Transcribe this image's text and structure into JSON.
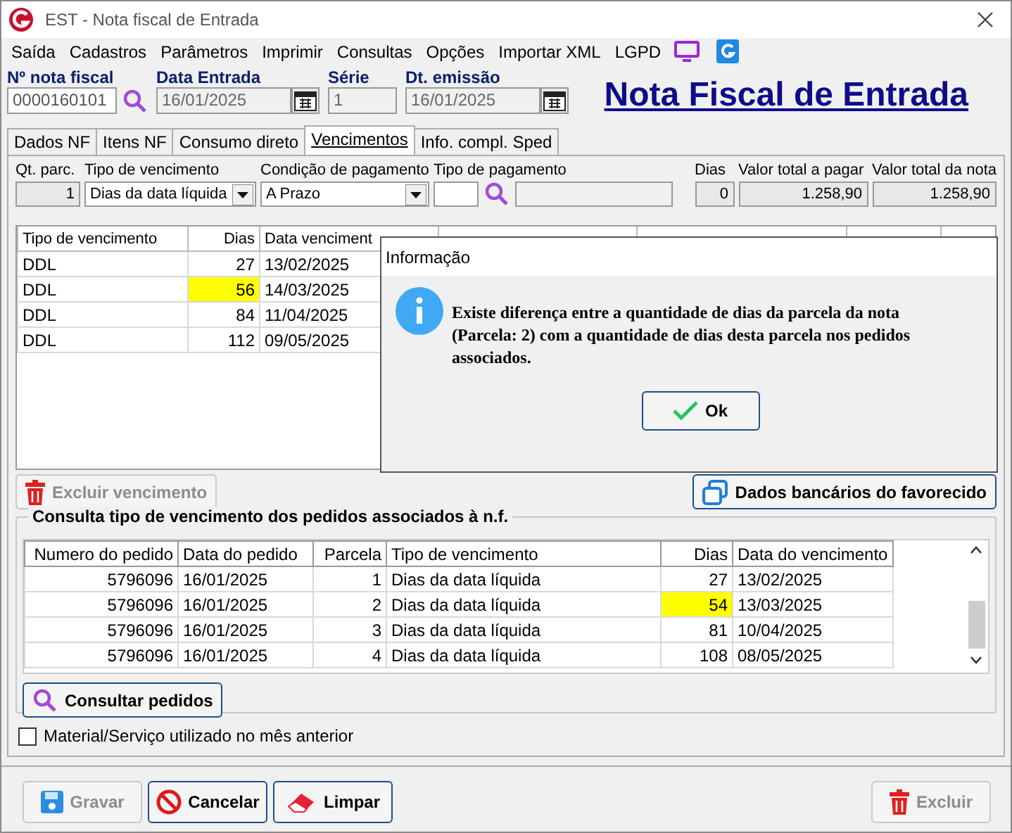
{
  "window": {
    "title": "EST - Nota fiscal de Entrada"
  },
  "menu": [
    {
      "label": "Saída"
    },
    {
      "label": "Cadastros"
    },
    {
      "label": "Parâmetros"
    },
    {
      "label": "Imprimir"
    },
    {
      "label": "Consultas"
    },
    {
      "label": "Opções"
    },
    {
      "label": "Importar XML"
    },
    {
      "label": "LGPD"
    }
  ],
  "header_fields": [
    {
      "label": "Nº nota fiscal",
      "value": "0000160101",
      "kind": "search"
    },
    {
      "label": "Data Entrada",
      "value": "16/01/2025",
      "kind": "date"
    },
    {
      "label": "Série",
      "value": "1",
      "kind": "text"
    },
    {
      "label": "Dt. emissão",
      "value": "16/01/2025",
      "kind": "date"
    }
  ],
  "page_title": "Nota Fiscal de Entrada",
  "tabs": [
    {
      "label": "Dados NF",
      "selected": false
    },
    {
      "label": "Itens NF",
      "selected": false
    },
    {
      "label": "Consumo direto",
      "selected": false
    },
    {
      "label": "Vencimentos",
      "selected": true
    },
    {
      "label": "Info. compl. Sped",
      "selected": false
    }
  ],
  "parcel_fields": [
    {
      "label": "Qt. parc.",
      "value": "1",
      "kind": "number"
    },
    {
      "label": "Tipo de vencimento",
      "value": "Dias da data líquida",
      "kind": "dropdown"
    },
    {
      "label": "Condição de pagamento",
      "value": "A Prazo",
      "kind": "dropdown"
    },
    {
      "label": "Tipo de pagamento",
      "kind": "lookup"
    },
    {
      "label": "Dias",
      "value": "0",
      "kind": "number"
    },
    {
      "label": "Valor total a pagar",
      "value": "1.258,90",
      "kind": "number"
    },
    {
      "label": "Valor total da nota",
      "value": "1.258,90",
      "kind": "number"
    }
  ],
  "vencimentos": {
    "columns": [
      "Tipo de vencimento",
      "Dias",
      "Data venciment"
    ],
    "rows": [
      {
        "cells": [
          "DDL",
          "27",
          "13/02/2025"
        ],
        "highlighted": false
      },
      {
        "cells": [
          "DDL",
          "56",
          "14/03/2025"
        ],
        "highlighted": true
      },
      {
        "cells": [
          "DDL",
          "84",
          "11/04/2025"
        ],
        "highlighted": false
      },
      {
        "cells": [
          "DDL",
          "112",
          "09/05/2025"
        ],
        "highlighted": false
      }
    ]
  },
  "excluir_vencimento": {
    "label": "Excluir vencimento",
    "disabled": true
  },
  "dados_bancarios": {
    "label": "Dados bancários do favorecido"
  },
  "pedidos": {
    "title": "Consulta tipo de vencimento dos pedidos associados à n.f.",
    "columns": [
      "Numero do pedido",
      "Data do pedido",
      "Parcela",
      "Tipo de vencimento",
      "Dias",
      "Data do vencimento"
    ],
    "rows": [
      {
        "cells": [
          "5796096",
          "16/01/2025",
          "1",
          "Dias da data líquida",
          "27",
          "13/02/2025"
        ],
        "highlighted": false
      },
      {
        "cells": [
          "5796096",
          "16/01/2025",
          "2",
          "Dias da data líquida",
          "54",
          "13/03/2025"
        ],
        "highlighted": true
      },
      {
        "cells": [
          "5796096",
          "16/01/2025",
          "3",
          "Dias da data líquida",
          "81",
          "10/04/2025"
        ],
        "highlighted": false
      },
      {
        "cells": [
          "5796096",
          "16/01/2025",
          "4",
          "Dias da data líquida",
          "108",
          "08/05/2025"
        ],
        "highlighted": false
      }
    ]
  },
  "consultar_pedidos": {
    "label": "Consultar pedidos"
  },
  "checkbox": {
    "label": "Material/Serviço utilizado no mês anterior",
    "checked": false
  },
  "footer_buttons": [
    {
      "label": "Gravar",
      "kind": "save",
      "disabled": true
    },
    {
      "label": "Cancelar",
      "kind": "cancel",
      "disabled": false
    },
    {
      "label": "Limpar",
      "kind": "clear",
      "disabled": false
    },
    {
      "label": "Excluir",
      "kind": "delete",
      "disabled": true
    }
  ],
  "dialog": {
    "title": "Informação",
    "message": "Existe diferença entre a quantidade de dias da parcela da nota (Parcela: 2) com a quantidade de dias desta parcela nos pedidos associados.",
    "button": "Ok"
  }
}
